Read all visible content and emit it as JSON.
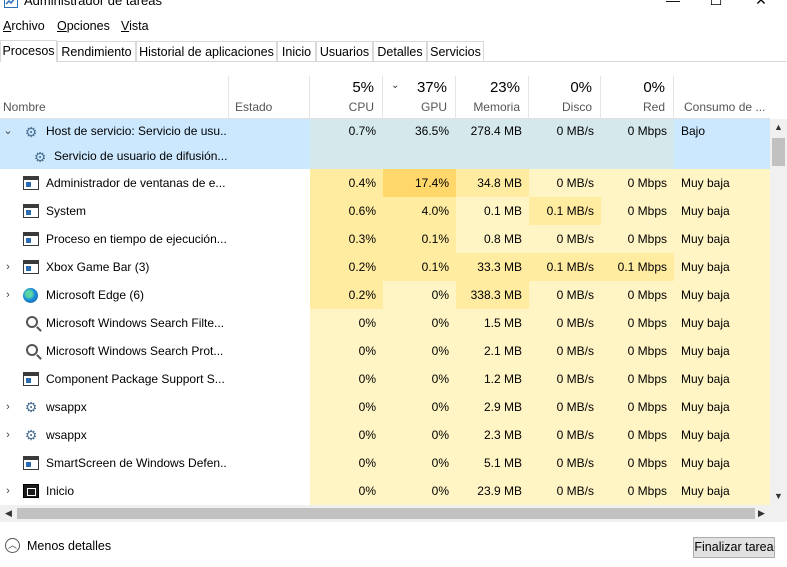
{
  "window": {
    "title": "Administrador de tareas",
    "controls": {
      "minimize": "—",
      "maximize": "☐",
      "close": "✕"
    }
  },
  "menu": [
    {
      "label": "Archivo"
    },
    {
      "label": "Opciones"
    },
    {
      "label": "Vista"
    }
  ],
  "tabs": [
    {
      "label": "Procesos",
      "active": true
    },
    {
      "label": "Rendimiento"
    },
    {
      "label": "Historial de aplicaciones"
    },
    {
      "label": "Inicio"
    },
    {
      "label": "Usuarios"
    },
    {
      "label": "Detalles"
    },
    {
      "label": "Servicios"
    }
  ],
  "columns": {
    "name": "Nombre",
    "status": "Estado",
    "cpu": {
      "pct": "5%",
      "label": "CPU"
    },
    "gpu": {
      "pct": "37%",
      "label": "GPU",
      "sorted": true
    },
    "mem": {
      "pct": "23%",
      "label": "Memoria"
    },
    "disk": {
      "pct": "0%",
      "label": "Disco"
    },
    "net": {
      "pct": "0%",
      "label": "Red"
    },
    "power": {
      "label": "Consumo de ..."
    }
  },
  "rows": [
    {
      "name": "Host de servicio: Servicio de usu...",
      "icon": "gear-icon",
      "expander": "collapse",
      "selected": true,
      "cpu": "0.7%",
      "gpu": "36.5%",
      "mem": "278.4 MB",
      "disk": "0 MB/s",
      "net": "0 Mbps",
      "power": "Bajo"
    },
    {
      "name": "Servicio de usuario de difusión...",
      "icon": "gear-icon",
      "child": true,
      "selected": true,
      "cpu": "",
      "gpu": "",
      "mem": "",
      "disk": "",
      "net": "",
      "power": ""
    },
    {
      "name": "Administrador de ventanas de e...",
      "icon": "window-icon",
      "cpu": "0.4%",
      "gpu": "17.4%",
      "mem": "34.8 MB",
      "disk": "0 MB/s",
      "net": "0 Mbps",
      "power": "Muy baja"
    },
    {
      "name": "System",
      "icon": "window-icon",
      "cpu": "0.6%",
      "gpu": "4.0%",
      "mem": "0.1 MB",
      "disk": "0.1 MB/s",
      "net": "0 Mbps",
      "power": "Muy baja"
    },
    {
      "name": "Proceso en tiempo de ejecución...",
      "icon": "window-icon",
      "cpu": "0.3%",
      "gpu": "0.1%",
      "mem": "0.8 MB",
      "disk": "0 MB/s",
      "net": "0 Mbps",
      "power": "Muy baja"
    },
    {
      "name": "Xbox Game Bar (3)",
      "icon": "window-icon",
      "expander": "expand",
      "cpu": "0.2%",
      "gpu": "0.1%",
      "mem": "33.3 MB",
      "disk": "0.1 MB/s",
      "net": "0.1 Mbps",
      "power": "Muy baja"
    },
    {
      "name": "Microsoft Edge (6)",
      "icon": "edge-icon",
      "expander": "expand",
      "cpu": "0.2%",
      "gpu": "0%",
      "mem": "338.3 MB",
      "disk": "0 MB/s",
      "net": "0 Mbps",
      "power": "Muy baja"
    },
    {
      "name": "Microsoft Windows Search Filte...",
      "icon": "search-icon",
      "cpu": "0%",
      "gpu": "0%",
      "mem": "1.5 MB",
      "disk": "0 MB/s",
      "net": "0 Mbps",
      "power": "Muy baja"
    },
    {
      "name": "Microsoft Windows Search Prot...",
      "icon": "search-icon",
      "cpu": "0%",
      "gpu": "0%",
      "mem": "2.1 MB",
      "disk": "0 MB/s",
      "net": "0 Mbps",
      "power": "Muy baja"
    },
    {
      "name": "Component Package Support S...",
      "icon": "window-icon",
      "cpu": "0%",
      "gpu": "0%",
      "mem": "1.2 MB",
      "disk": "0 MB/s",
      "net": "0 Mbps",
      "power": "Muy baja"
    },
    {
      "name": "wsappx",
      "icon": "gear-icon",
      "expander": "expand",
      "cpu": "0%",
      "gpu": "0%",
      "mem": "2.9 MB",
      "disk": "0 MB/s",
      "net": "0 Mbps",
      "power": "Muy baja"
    },
    {
      "name": "wsappx",
      "icon": "gear-icon",
      "expander": "expand",
      "cpu": "0%",
      "gpu": "0%",
      "mem": "2.3 MB",
      "disk": "0 MB/s",
      "net": "0 Mbps",
      "power": "Muy baja"
    },
    {
      "name": "SmartScreen de Windows Defen...",
      "icon": "window-icon",
      "cpu": "0%",
      "gpu": "0%",
      "mem": "5.1 MB",
      "disk": "0 MB/s",
      "net": "0 Mbps",
      "power": "Muy baja"
    },
    {
      "name": "Inicio",
      "icon": "terminal-icon",
      "expander": "expand",
      "cpu": "0%",
      "gpu": "0%",
      "mem": "23.9 MB",
      "disk": "0 MB/s",
      "net": "0 Mbps",
      "power": "Muy baja"
    }
  ],
  "footer": {
    "less_details": "Menos detalles",
    "end_task": "Finalizar tarea"
  },
  "colors": {
    "selected": "#cce8ff",
    "heat_low": "#fff4c4",
    "heat_mid": "#ffeca0",
    "heat_high": "#ffd76a"
  }
}
